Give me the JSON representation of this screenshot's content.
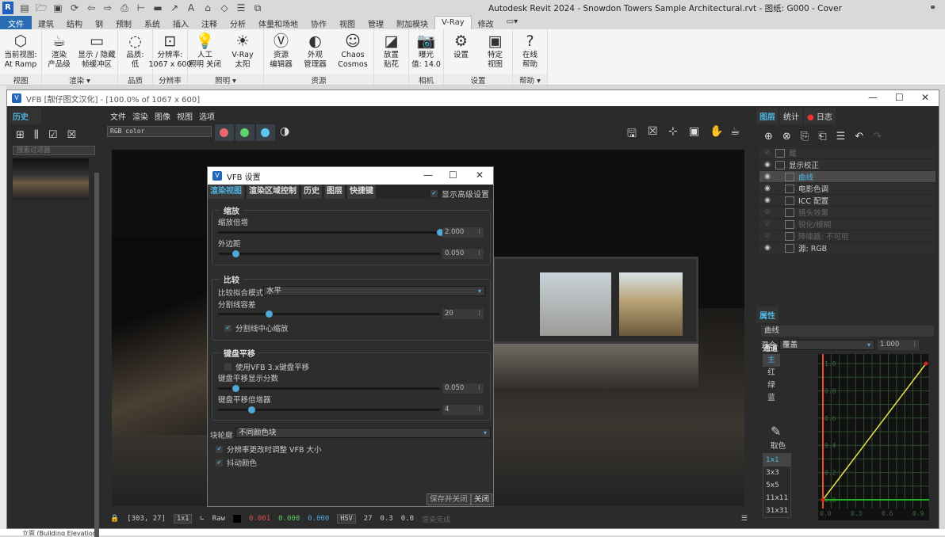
{
  "revit": {
    "title": "Autodesk Revit 2024 - Snowdon Towers Sample Architectural.rvt - 图纸: G000 - Cover",
    "tabs": [
      "文件",
      "建筑",
      "结构",
      "钢",
      "预制",
      "系统",
      "插入",
      "注释",
      "分析",
      "体量和场地",
      "协作",
      "视图",
      "管理",
      "附加模块",
      "V-Ray",
      "修改"
    ],
    "active_tab": "V-Ray",
    "ribbon_groups": [
      {
        "label": "视图",
        "buttons": [
          {
            "l1": "当前视图:",
            "l2": "At Ramp",
            "icon": "view-cube-icon"
          }
        ]
      },
      {
        "label": "渲染 ▾",
        "buttons": [
          {
            "l1": "渲染",
            "l2": "产品级",
            "icon": "teapot-icon"
          },
          {
            "l1": "显示 / 隐藏",
            "l2": "帧缓冲区",
            "icon": "frame-buffer-icon"
          }
        ]
      },
      {
        "label": "品质",
        "buttons": [
          {
            "l1": "品质:",
            "l2": "低",
            "icon": "quality-icon"
          }
        ]
      },
      {
        "label": "分辨率",
        "buttons": [
          {
            "l1": "分辨率:",
            "l2": "1067 x 600",
            "icon": "resolution-icon"
          }
        ]
      },
      {
        "label": "照明 ▾",
        "buttons": [
          {
            "l1": "人工",
            "l2": "照明 关闭",
            "icon": "bulb-icon"
          },
          {
            "l1": "V-Ray",
            "l2": "太阳",
            "icon": "sun-icon"
          }
        ]
      },
      {
        "label": "资源",
        "buttons": [
          {
            "l1": "资源",
            "l2": "编辑器",
            "icon": "vray-logo-icon"
          },
          {
            "l1": "外观",
            "l2": "管理器",
            "icon": "appearance-icon"
          },
          {
            "l1": "Chaos",
            "l2": "Cosmos",
            "icon": "cosmos-icon"
          }
        ]
      },
      {
        "label": "",
        "buttons": [
          {
            "l1": "放置",
            "l2": "贴花",
            "icon": "decal-icon"
          }
        ]
      },
      {
        "label": "相机",
        "buttons": [
          {
            "l1": "曝光",
            "l2": "值: 14.0",
            "icon": "camera-icon"
          }
        ]
      },
      {
        "label": "设置",
        "buttons": [
          {
            "l1": "设置",
            "l2": "",
            "icon": "gear-icon"
          },
          {
            "l1": "特定",
            "l2": "视图",
            "icon": "view-settings-icon"
          }
        ]
      },
      {
        "label": "帮助 ▾",
        "buttons": [
          {
            "l1": "在线",
            "l2": "帮助",
            "icon": "help-icon"
          }
        ]
      }
    ],
    "bottom_text": "立面 (Building Elevation)"
  },
  "vfb": {
    "title": "VFB [靓仔图文汉化] - [100.0% of 1067 x 600]",
    "history_title": "历史",
    "search_placeholder": "搜索过滤器",
    "menu": [
      "文件",
      "渲染",
      "图像",
      "视图",
      "选项"
    ],
    "channel": "RGB color",
    "colors": {
      "red": "#e8686c",
      "green": "#5fd36b",
      "blue": "#5fc4f0",
      "accent": "#4fb3e0"
    },
    "status": {
      "coords": "[303, 27]",
      "sample": "1x1",
      "raw": "Raw",
      "r": "0.001",
      "g": "0.000",
      "b": "0.000",
      "mode": "HSV",
      "h": "27",
      "s": "0.3",
      "v": "0.0",
      "state": "渲染完成"
    },
    "right_tabs": [
      "图层",
      "统计",
      "日志"
    ],
    "layers": [
      {
        "label": "藏",
        "visible": false,
        "indent": 0
      },
      {
        "label": "显示校正",
        "visible": true,
        "indent": 0
      },
      {
        "label": "曲线",
        "visible": true,
        "indent": 1,
        "selected": true
      },
      {
        "label": "电影色调",
        "visible": true,
        "indent": 1
      },
      {
        "label": "ICC 配置",
        "visible": true,
        "indent": 1
      },
      {
        "label": "镜头效果",
        "visible": false,
        "indent": 1
      },
      {
        "label": "锐化/模糊",
        "visible": false,
        "indent": 1
      },
      {
        "label": "降噪器: 不可用",
        "visible": false,
        "indent": 1
      },
      {
        "label": "源: RGB",
        "visible": true,
        "indent": 1
      }
    ],
    "props": {
      "title": "属性",
      "name": "曲线",
      "blend_label": "混合",
      "blend": "覆盖",
      "opacity": "1.000",
      "channel_title": "通道",
      "channels": [
        "主",
        "红",
        "绿",
        "蓝"
      ],
      "picker": "取色",
      "samples": [
        "1x1",
        "3x3",
        "5x5",
        "11x11",
        "31x31"
      ]
    },
    "chart_data": {
      "type": "line",
      "title": "曲线",
      "x_ticks": [
        "0.0",
        "0.3",
        "0.6",
        "0.9"
      ],
      "y_ticks": [
        "0.0",
        "0.2",
        "0.4",
        "0.6",
        "0.8",
        "1.0"
      ],
      "xlim": [
        0,
        1
      ],
      "ylim": [
        0,
        1
      ],
      "series": [
        {
          "name": "主",
          "points": [
            [
              0,
              0
            ],
            [
              1,
              1
            ]
          ],
          "color": "#e8e24a"
        }
      ],
      "grid": true
    }
  },
  "dialog": {
    "title": "VFB 设置",
    "tabs": [
      "渲染视图",
      "渲染区域控制",
      "历史",
      "图层",
      "快捷键"
    ],
    "advanced": "显示高级设置",
    "zoom": {
      "legend": "缩放",
      "mult_label": "缩放倍增",
      "mult": "2.000",
      "mult_pct": 100,
      "margin_label": "外边距",
      "margin": "0.050",
      "margin_pct": 8
    },
    "compare": {
      "legend": "比较",
      "mode_label": "比较拟合模式",
      "mode": "水平",
      "tol_label": "分割线容差",
      "tol": "20",
      "tol_pct": 23,
      "center": "分割线中心缩放"
    },
    "pan": {
      "legend": "键盘平移",
      "legacy": "使用VFB 3.x键盘平移",
      "frac_label": "键盘平移显示分数",
      "frac": "0.050",
      "frac_pct": 8,
      "mult_label": "键盘平移倍增器",
      "mult": "4",
      "mult_pct": 15
    },
    "outline_label": "块轮廓",
    "outline": "不同颜色块",
    "resize": "分辨率更改时调整 VFB 大小",
    "dither": "抖动颜色",
    "save_close": "保存并关闭",
    "close": "关闭"
  }
}
